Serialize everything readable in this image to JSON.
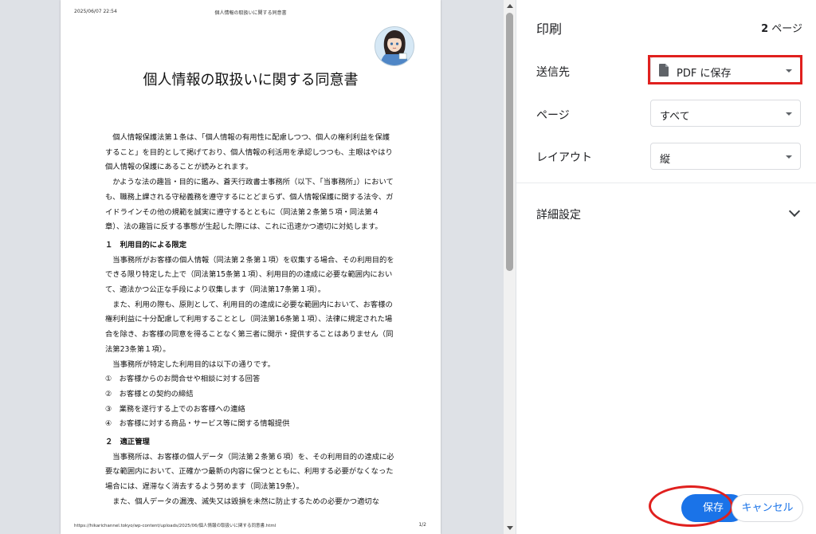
{
  "document": {
    "header_datetime": "2025/06/07 22:54",
    "header_title": "個人情報の取扱いに関する同意書",
    "title": "個人情報の取扱いに関する同意書",
    "paragraphs": [
      {
        "kind": "ind",
        "text": "個人情報保護法第１条は、「個人情報の有用性に配慮しつつ、個人の権利利益を保護すること」を目的として掲げており、個人情報の利活用を承認しつつも、主眼はやはり個人情報の保護にあることが読みとれます。"
      },
      {
        "kind": "ind",
        "text": "かような法の趣旨・目的に鑑み、蒼天行政書士事務所（以下、「当事務所」）においても、職務上課される守秘義務を遵守するにとどまらず、個人情報保護に関する法令、ガイドラインその他の規範を誠実に遵守するとともに（同法第２条第５項・同法第４章）、法の趣旨に反する事態が生起した際には、これに迅速かつ適切に対処します。"
      },
      {
        "kind": "sec",
        "text": "１　利用目的による限定"
      },
      {
        "kind": "ind",
        "text": "当事務所がお客様の個人情報（同法第２条第１項）を収集する場合、その利用目的をできる限り特定した上で（同法第15条第１項）、利用目的の達成に必要な範囲内において、適法かつ公正な手段により収集します（同法第17条第１項）。"
      },
      {
        "kind": "ind",
        "text": "また、利用の際も、原則として、利用目的の達成に必要な範囲内において、お客様の権利利益に十分配慮して利用することとし（同法第16条第１項）、法律に規定された場合を除き、お客様の同意を得ることなく第三者に開示・提供することはありません（同法第23条第１項）。"
      },
      {
        "kind": "ind",
        "text": "当事務所が特定した利用目的は以下の通りです。"
      },
      {
        "kind": "item",
        "text": "①　お客様からのお問合せや相談に対する回答"
      },
      {
        "kind": "item",
        "text": "②　お客様との契約の締結"
      },
      {
        "kind": "item",
        "text": "③　業務を遂行する上でのお客様への連絡"
      },
      {
        "kind": "item",
        "text": "④　お客様に対する商品・サービス等に関する情報提供"
      },
      {
        "kind": "sec",
        "text": "２　適正管理"
      },
      {
        "kind": "ind",
        "text": "当事務所は、お客様の個人データ（同法第２条第６項）を、その利用目的の達成に必要な範囲内において、正確かつ最新の内容に保つとともに、利用する必要がなくなった場合には、遅滞なく消去するよう努めます（同法第19条）。"
      },
      {
        "kind": "ind",
        "text": "また、個人データの漏洩、滅失又は毀損を未然に防止するための必要かつ適切な"
      }
    ],
    "footer_url": "https://hikarichannel.tokyo/wp-content/uploads/2025/06/個人情報の取扱いに関する同意書.html",
    "footer_page": "1/2"
  },
  "panel": {
    "title": "印刷",
    "page_count_num": "2",
    "page_count_unit": " ページ",
    "destination_label": "送信先",
    "destination_value": "PDF に保存",
    "pages_label": "ページ",
    "pages_value": "すべて",
    "layout_label": "レイアウト",
    "layout_value": "縦",
    "advanced_label": "詳細設定",
    "save_label": "保存",
    "cancel_label": "キャンセル"
  },
  "colors": {
    "accent": "#1a73e8",
    "highlight": "#e0201e"
  }
}
